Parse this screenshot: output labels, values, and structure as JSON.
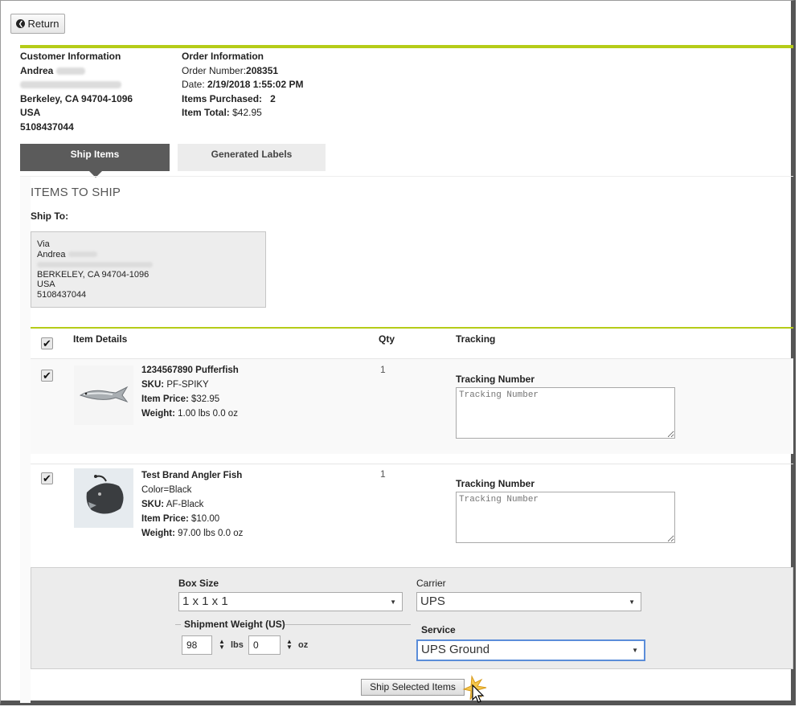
{
  "return_button": {
    "label": "Return",
    "icon": "chevron-left-circle-icon"
  },
  "customer": {
    "heading": "Customer Information",
    "first_name": "Andrea",
    "city_line": "Berkeley, CA 94704-1096",
    "country": "USA",
    "phone": "5108437044"
  },
  "order": {
    "heading": "Order Information",
    "number_label": "Order Number:",
    "number": "208351",
    "date_label": "Date:",
    "date": "2/19/2018 1:55:02 PM",
    "items_label": "Items Purchased:",
    "items_count": "2",
    "total_label": "Item Total:",
    "total": "$42.95"
  },
  "tabs": [
    {
      "label": "Ship Items",
      "active": true
    },
    {
      "label": "Generated Labels",
      "active": false
    }
  ],
  "section_title": "ITEMS TO SHIP",
  "ship_to": {
    "label": "Ship To:",
    "via": "Via",
    "first_name": "Andrea",
    "city_line": "BERKELEY, CA 94704-1096",
    "country": "USA",
    "phone": "5108437044"
  },
  "table": {
    "headers": {
      "details": "Item Details",
      "qty": "Qty",
      "tracking": "Tracking"
    },
    "items": [
      {
        "checked": true,
        "title": "1234567890 Pufferfish",
        "sku_label": "SKU:",
        "sku": "PF-SPIKY",
        "price_label": "Item Price:",
        "price": "$32.95",
        "weight_label": "Weight:",
        "weight": "1.00 lbs 0.0 oz",
        "qty": "1",
        "tracking_label": "Tracking Number",
        "tracking_placeholder": "Tracking Number"
      },
      {
        "checked": true,
        "title": "Test Brand Angler Fish",
        "option": "Color=Black",
        "sku_label": "SKU:",
        "sku": "AF-Black",
        "price_label": "Item Price:",
        "price": "$10.00",
        "weight_label": "Weight:",
        "weight": "97.00 lbs 0.0 oz",
        "qty": "1",
        "tracking_label": "Tracking Number",
        "tracking_placeholder": "Tracking Number"
      }
    ]
  },
  "shipping": {
    "box_size_label": "Box Size",
    "box_size": "1 x 1 x 1",
    "carrier_label": "Carrier",
    "carrier": "UPS",
    "weight_legend": "Shipment Weight (US)",
    "weight_lbs": "98",
    "lbs_unit": "lbs",
    "weight_oz": "0",
    "oz_unit": "oz",
    "service_label": "Service",
    "service": "UPS Ground"
  },
  "ship_button": {
    "label": "Ship Selected Items"
  },
  "colors": {
    "accent": "#b5cc18",
    "tab_active": "#5b5b5b",
    "service_border": "#5b8dd9"
  }
}
